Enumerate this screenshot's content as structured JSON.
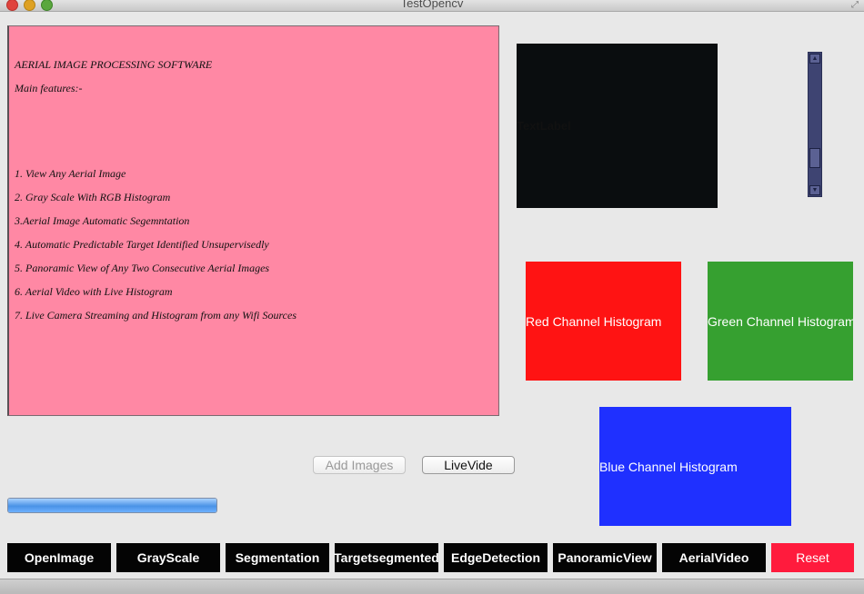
{
  "window": {
    "title": "TestOpencv"
  },
  "text_panel": {
    "lines": [
      "AERIAL IMAGE PROCESSING SOFTWARE",
      "Main features:-",
      "1. View Any Aerial Image",
      "2. Gray Scale With RGB Histogram",
      "3.Aerial Image Automatic Segemntation",
      "4. Automatic Predictable Target Identified Unsupervisedly",
      "5. Panoramic View of Any Two Consecutive Aerial Images",
      "6. Aerial Video with Live Histogram",
      "7. Live Camera Streaming and Histogram from any Wifi Sources"
    ]
  },
  "image_label": {
    "text": "TextLabel"
  },
  "histograms": {
    "red": "Red Channel Histogram",
    "green": "Green Channel Histogram",
    "blue": "Blue Channel Histogram"
  },
  "buttons": {
    "add_images": "Add Images",
    "live_video": "LiveVide"
  },
  "progress": {
    "value_percent": 100
  },
  "toolbar": [
    "OpenImage",
    "GrayScale",
    "Segmentation",
    "Targetsegmented",
    "EdgeDetection",
    "PanoramicView",
    "AerialVideo",
    "Reset"
  ],
  "colors": {
    "text_panel_bg": "#ff88a4",
    "red_panel": "#ff1313",
    "green_panel": "#36a030",
    "blue_panel": "#1f30ff",
    "reset": "#ff1b3d"
  }
}
